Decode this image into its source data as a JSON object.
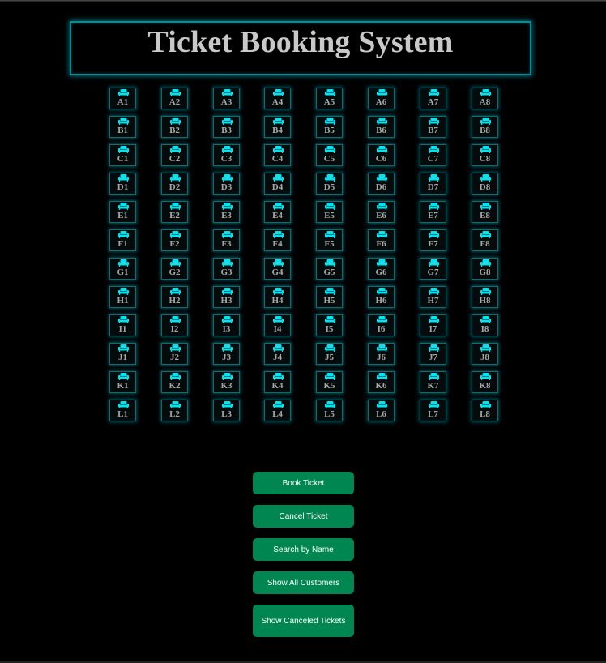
{
  "title": "Ticket Booking System",
  "colors": {
    "background": "#000000",
    "seat_icon": "#00e5f0",
    "seat_border": "#0e6c74",
    "button": "#008751",
    "title_text": "#c9c9c9"
  },
  "seats": {
    "icon": "seat-icon",
    "rows": [
      "A",
      "B",
      "C",
      "D",
      "E",
      "F",
      "G",
      "H",
      "I",
      "J",
      "K",
      "L"
    ],
    "columns": [
      1,
      2,
      3,
      4,
      5,
      6,
      7,
      8
    ]
  },
  "buttons": {
    "book": "Book Ticket",
    "cancel": "Cancel Ticket",
    "search": "Search by Name",
    "show_all": "Show All Customers",
    "show_canceled": "Show Canceled Tickets"
  }
}
